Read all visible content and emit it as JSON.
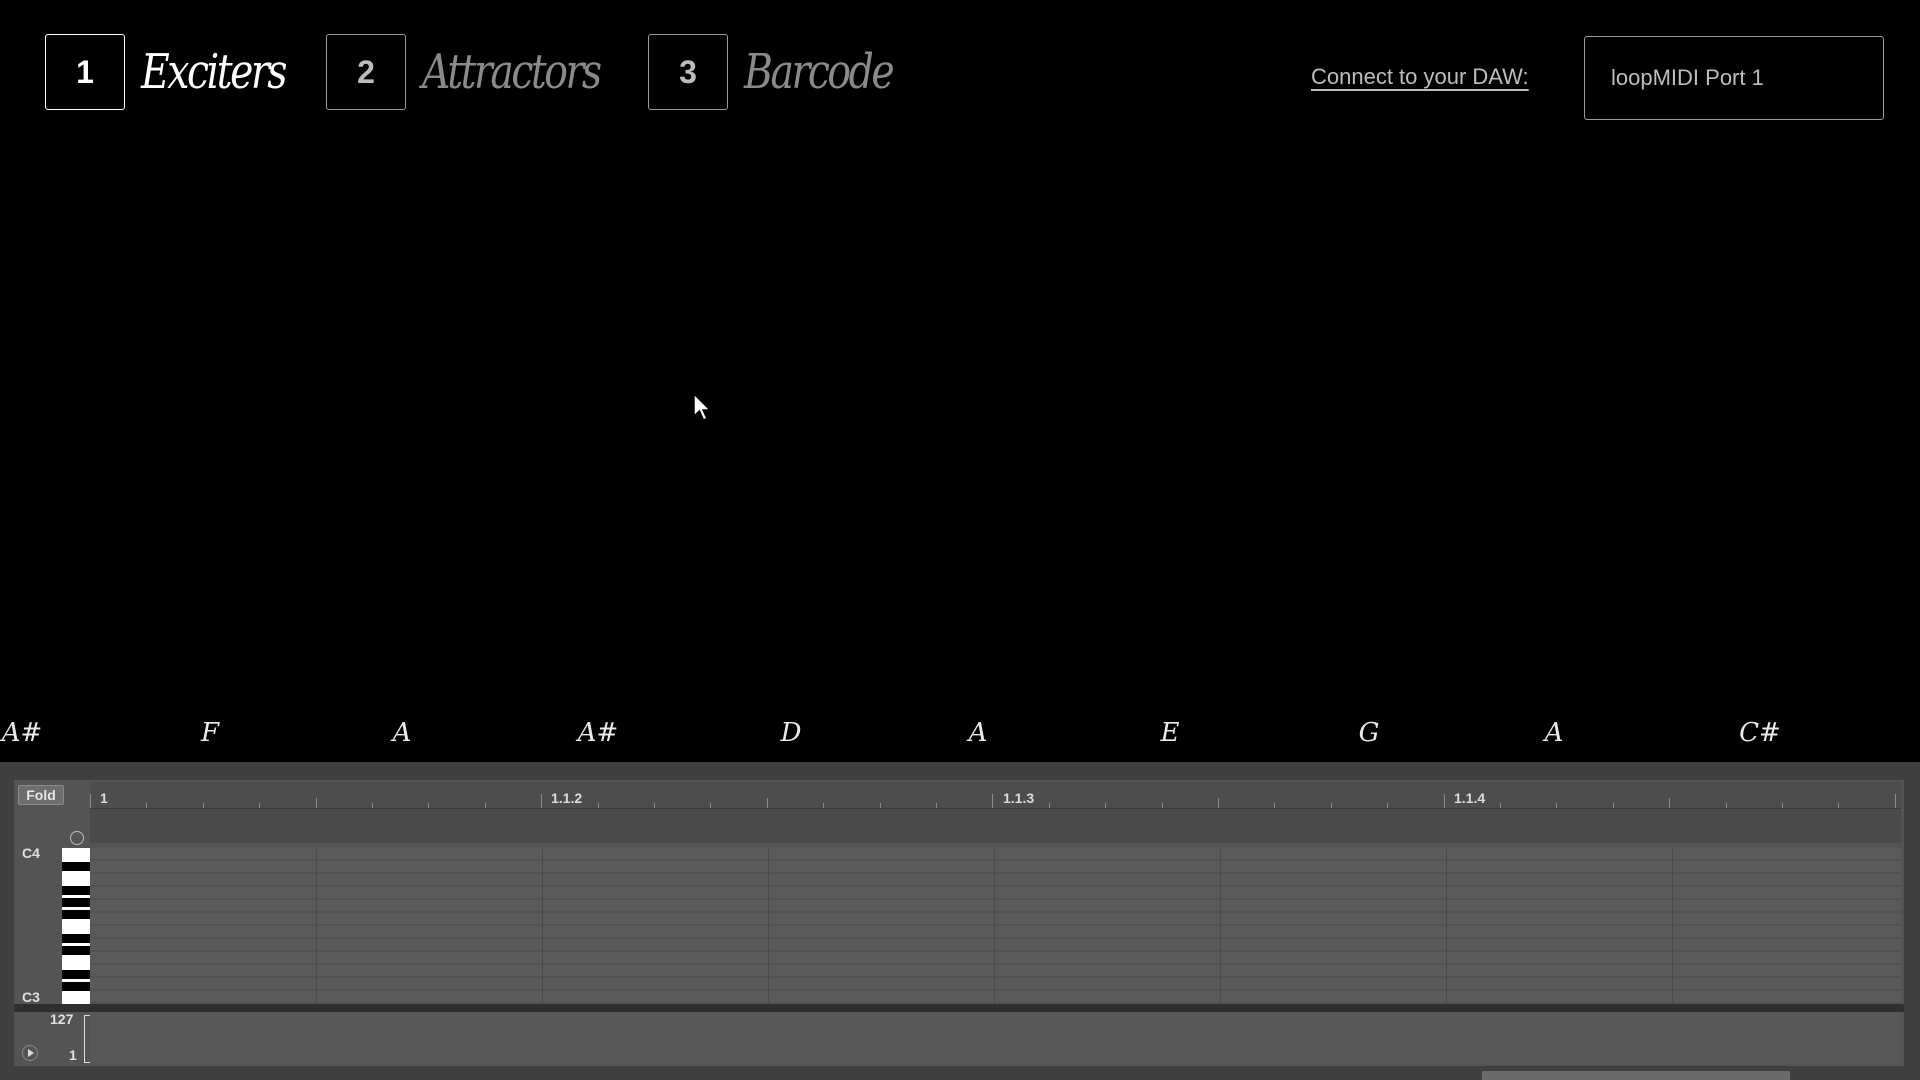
{
  "nav": {
    "tabs": [
      {
        "number": "1",
        "label": "Exciters",
        "active": true
      },
      {
        "number": "2",
        "label": "Attractors",
        "active": false
      },
      {
        "number": "3",
        "label": "Barcode",
        "active": false
      }
    ],
    "daw_link": "Connect to your DAW:",
    "port_select_value": "loopMIDI Port 1"
  },
  "notes": [
    "A#",
    "F",
    "A",
    "A#",
    "D",
    "A",
    "E",
    "G",
    "A",
    "C#"
  ],
  "piano_roll": {
    "fold_label": "Fold",
    "bar_labels": [
      "1",
      "1.1.2",
      "1.1.3",
      "1.1.4"
    ],
    "key_high": "C4",
    "key_low": "C3",
    "velocity_max": "127",
    "velocity_min": "1"
  },
  "colors": {
    "background": "#000000",
    "active_text": "#ffffff",
    "inactive_text": "#8a8a8a",
    "roll_panel": "#545454"
  }
}
